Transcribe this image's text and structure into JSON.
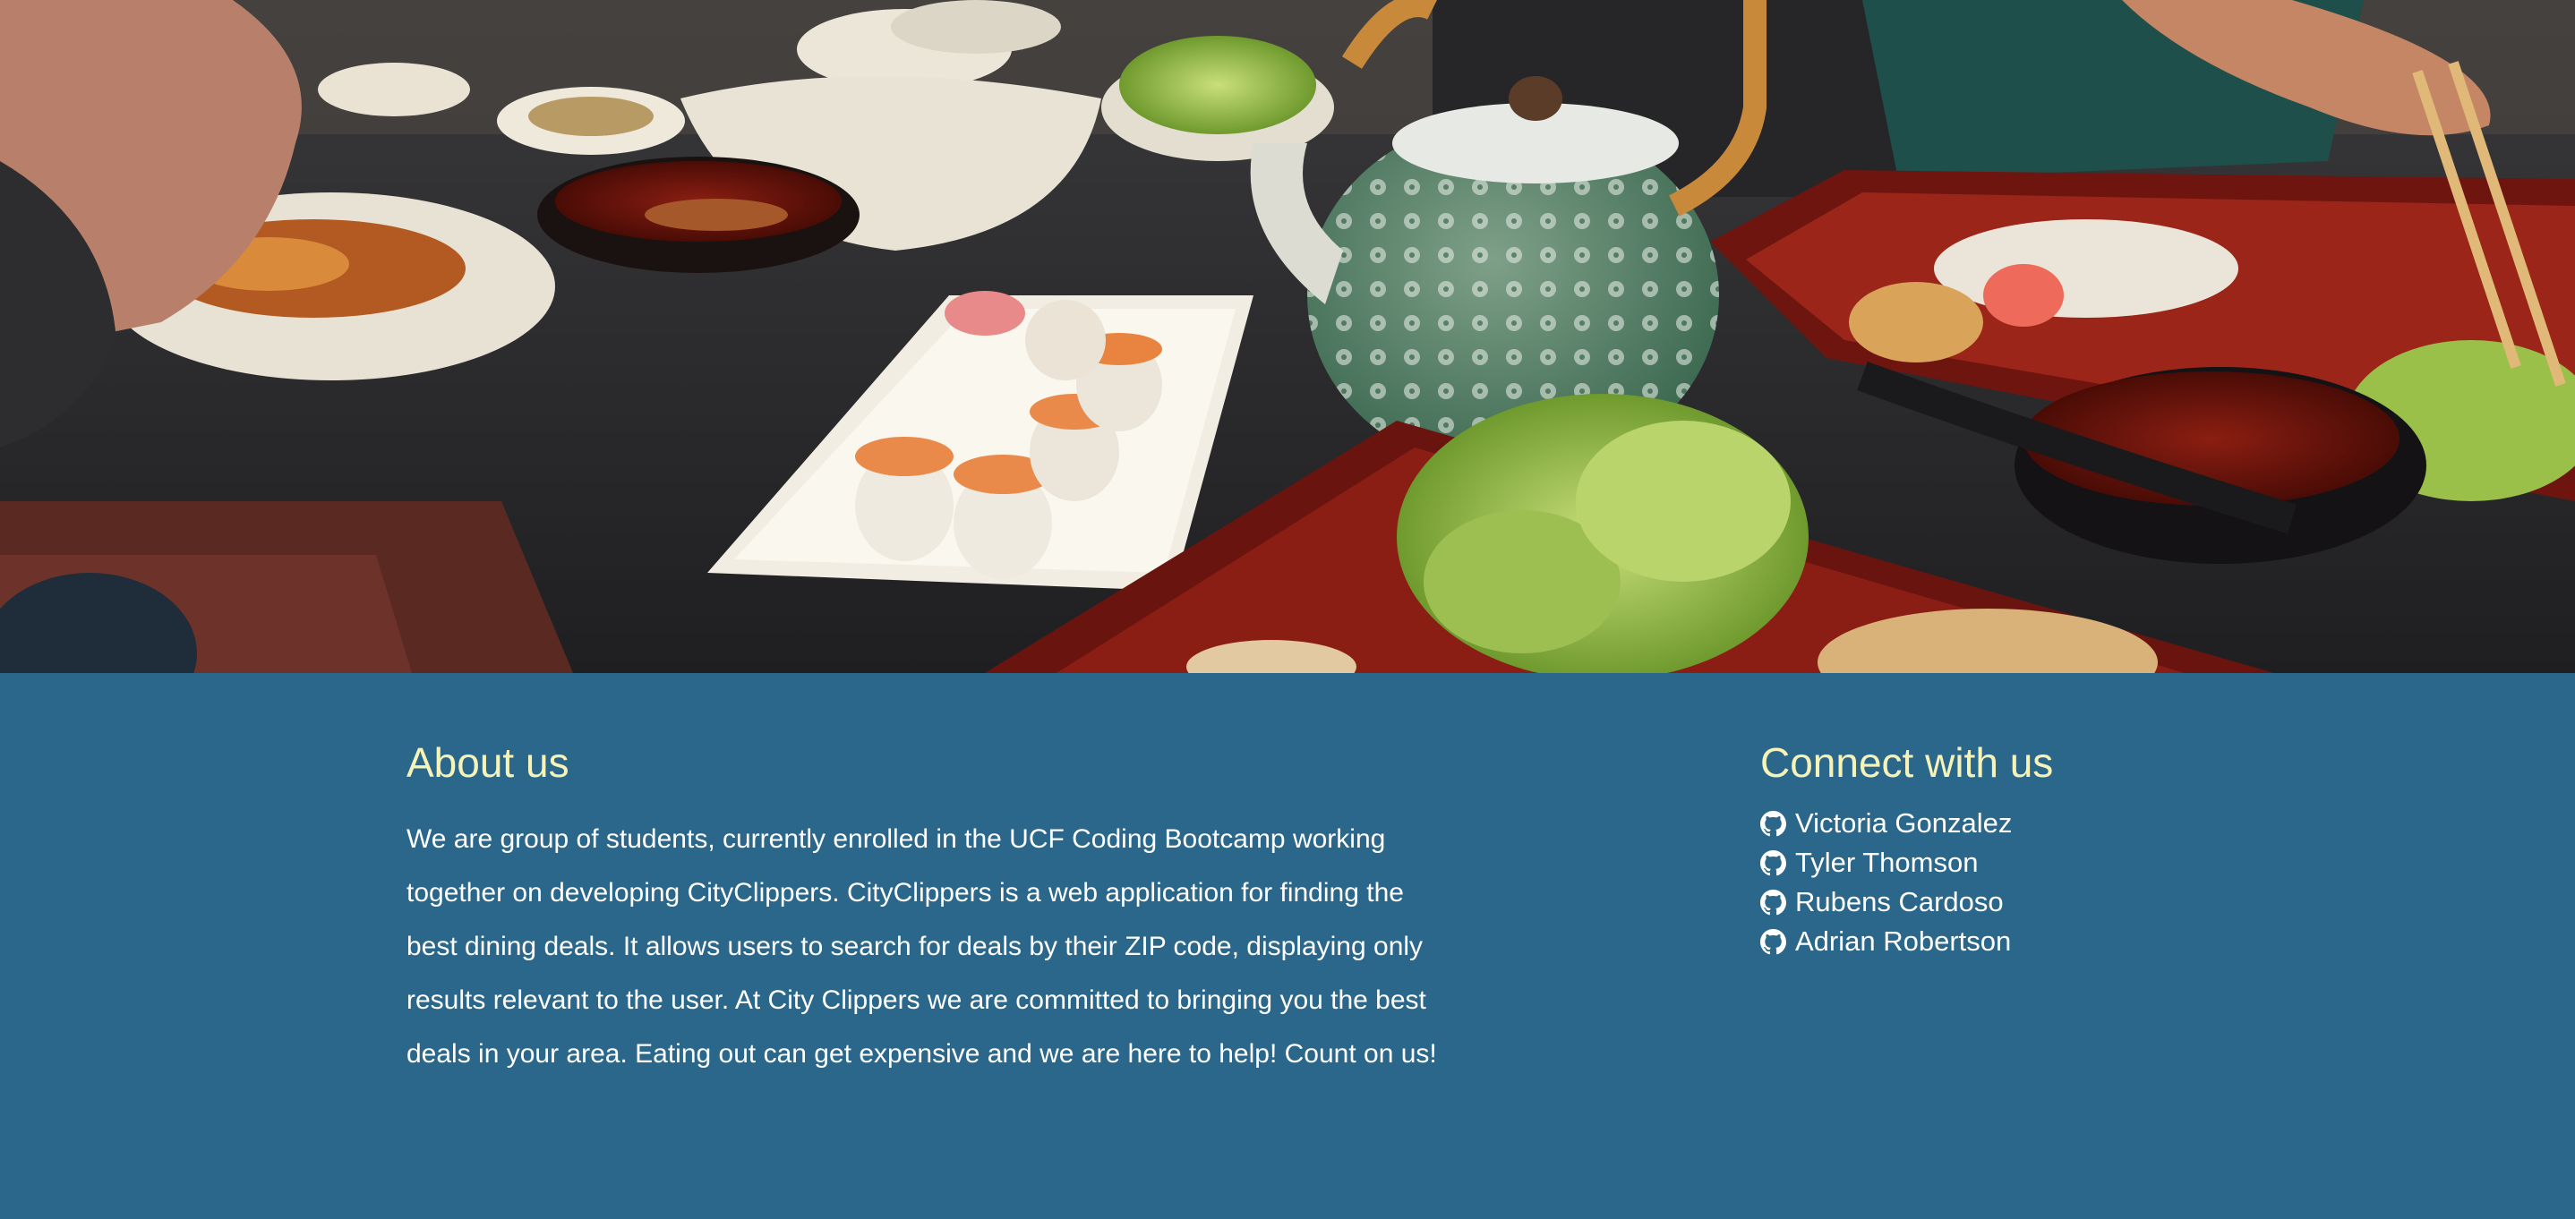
{
  "hero": {
    "image_description_icon": "restaurant-photo"
  },
  "about": {
    "heading": "About us",
    "body": "We are group of students, currently enrolled in the UCF Coding Bootcamp working together on developing CityClippers. CityClippers is a web application for finding the best dining deals. It allows users to search for deals by their ZIP code, displaying only results relevant to the user. At City Clippers we are committed to bringing you the best deals in your area. Eating out can get expensive and we are here to help! Count on us!"
  },
  "connect": {
    "heading": "Connect with us",
    "icon": "github-icon",
    "links": [
      {
        "label": "Victoria Gonzalez"
      },
      {
        "label": "Tyler Thomson"
      },
      {
        "label": "Rubens Cardoso"
      },
      {
        "label": "Adrian Robertson"
      }
    ]
  },
  "colors": {
    "footer_bg": "#2a678b",
    "heading": "#f6f3b8",
    "text": "#ffffff"
  }
}
